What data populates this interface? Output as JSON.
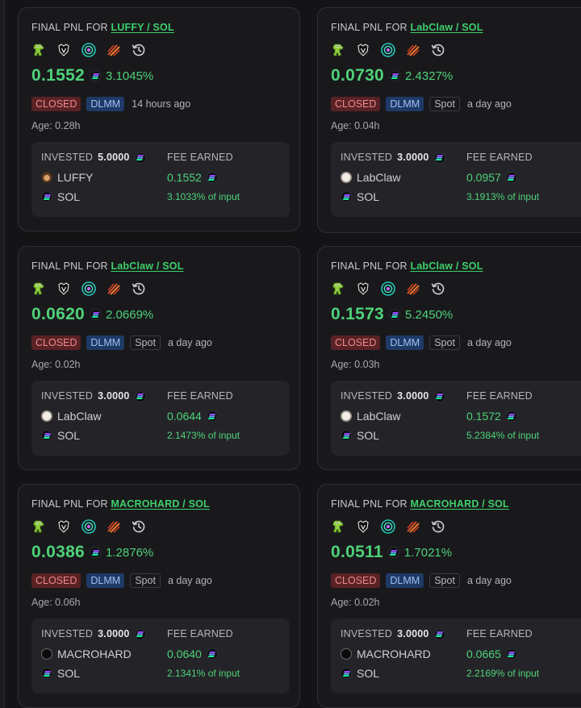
{
  "cards": [
    {
      "title_prefix": "FINAL PNL FOR",
      "pair": "LUFFY / SOL",
      "pnl": "0.1552",
      "pnl_pct": "3.1045%",
      "status": "CLOSED",
      "pool_type": "DLMM",
      "strategy": "",
      "time": "14 hours ago",
      "age": "Age: 0.28h",
      "invested_label": "INVESTED",
      "invested": "5.0000",
      "fee_label": "FEE EARNED",
      "token": "LUFFY",
      "token_icon": "luffy-token-icon",
      "quote": "SOL",
      "fee": "0.1552",
      "fee_pct": "3.1033% of input"
    },
    {
      "title_prefix": "FINAL PNL FOR",
      "pair": "LabClaw / SOL",
      "pnl": "0.0730",
      "pnl_pct": "2.4327%",
      "status": "CLOSED",
      "pool_type": "DLMM",
      "strategy": "Spot",
      "time": "a day ago",
      "age": "Age: 0.04h",
      "invested_label": "INVESTED",
      "invested": "3.0000",
      "fee_label": "FEE EARNED",
      "token": "LabClaw",
      "token_icon": "labclaw-token-icon",
      "quote": "SOL",
      "fee": "0.0957",
      "fee_pct": "3.1913% of input"
    },
    {
      "title_prefix": "FINAL PNL FOR",
      "pair": "LabClaw / SOL",
      "pnl": "0.0620",
      "pnl_pct": "2.0669%",
      "status": "CLOSED",
      "pool_type": "DLMM",
      "strategy": "Spot",
      "time": "a day ago",
      "age": "Age: 0.02h",
      "invested_label": "INVESTED",
      "invested": "3.0000",
      "fee_label": "FEE EARNED",
      "token": "LabClaw",
      "token_icon": "labclaw-token-icon",
      "quote": "SOL",
      "fee": "0.0644",
      "fee_pct": "2.1473% of input"
    },
    {
      "title_prefix": "FINAL PNL FOR",
      "pair": "LabClaw / SOL",
      "pnl": "0.1573",
      "pnl_pct": "5.2450%",
      "status": "CLOSED",
      "pool_type": "DLMM",
      "strategy": "Spot",
      "time": "a day ago",
      "age": "Age: 0.03h",
      "invested_label": "INVESTED",
      "invested": "3.0000",
      "fee_label": "FEE EARNED",
      "token": "LabClaw",
      "token_icon": "labclaw-token-icon",
      "quote": "SOL",
      "fee": "0.1572",
      "fee_pct": "5.2384% of input"
    },
    {
      "title_prefix": "FINAL PNL FOR",
      "pair": "MACROHARD / SOL",
      "pnl": "0.0386",
      "pnl_pct": "1.2876%",
      "status": "CLOSED",
      "pool_type": "DLMM",
      "strategy": "Spot",
      "time": "a day ago",
      "age": "Age: 0.06h",
      "invested_label": "INVESTED",
      "invested": "3.0000",
      "fee_label": "FEE EARNED",
      "token": "MACROHARD",
      "token_icon": "macrohard-token-icon",
      "quote": "SOL",
      "fee": "0.0640",
      "fee_pct": "2.1341% of input"
    },
    {
      "title_prefix": "FINAL PNL FOR",
      "pair": "MACROHARD / SOL",
      "pnl": "0.0511",
      "pnl_pct": "1.7021%",
      "status": "CLOSED",
      "pool_type": "DLMM",
      "strategy": "Spot",
      "time": "a day ago",
      "age": "Age: 0.02h",
      "invested_label": "INVESTED",
      "invested": "3.0000",
      "fee_label": "FEE EARNED",
      "token": "MACROHARD",
      "token_icon": "macrohard-token-icon",
      "quote": "SOL",
      "fee": "0.0665",
      "fee_pct": "2.2169% of input"
    }
  ],
  "link_icons": [
    "gecko-icon",
    "bubblemaps-icon",
    "jupiter-icon",
    "meteora-icon",
    "history-icon"
  ],
  "colors": {
    "background": "#141416",
    "card": "#19191c",
    "positive": "#4fd279",
    "pair_link": "#3ecf6a",
    "closed_bg": "#5a2225",
    "closed_text": "#ee8a8c",
    "dlmm_bg": "#1f3a66",
    "dlmm_text": "#9cc0f1"
  }
}
